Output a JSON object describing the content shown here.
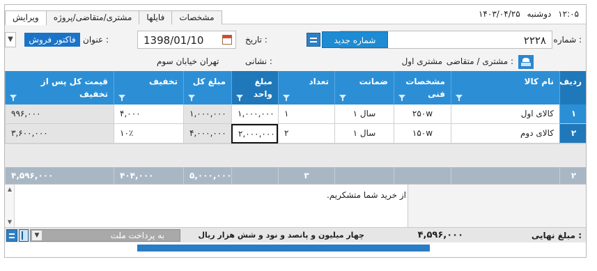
{
  "tabs": [
    "ویرایش",
    "مشتری/متقاضی/پروژه",
    "فایلها",
    "مشخصات"
  ],
  "datetime": {
    "weekday": "دوشنبه",
    "date": "۱۴۰۳/۰۴/۲۵",
    "time": "۱۲:۰۵"
  },
  "header": {
    "number_label": "شماره :",
    "number_value": "۲۲۲۸",
    "new_number_button": "شماره جدید",
    "date_label": "تاریخ :",
    "date_value": "1398/01/10",
    "title_label": "عنوان :",
    "title_value": "فاکتور فروش",
    "customer_label": "مشتری / متقاضی :",
    "customer_value": "مشتری اول",
    "address_label": "نشانی :",
    "address_value": "تهران خیابان سوم"
  },
  "columns": [
    "ردیف",
    "نام کالا",
    "مشخصات فنی",
    "ضمانت",
    "تعداد",
    "مبلغ واحد",
    "مبلغ کل",
    "تخفیف",
    "قیمت کل پس از تخفیف"
  ],
  "rows": [
    [
      "۱",
      "کالای اول",
      "۲۵۰w",
      "۱ سال",
      "۱",
      "۱,۰۰۰,۰۰۰",
      "۱,۰۰۰,۰۰۰",
      "۴,۰۰۰",
      "۹۹۶,۰۰۰"
    ],
    [
      "۲",
      "کالای دوم",
      "۱۵۰w",
      "۱ سال",
      "۲",
      "۲,۰۰۰,۰۰۰",
      "۴,۰۰۰,۰۰۰",
      "۱۰٪",
      "۳,۶۰۰,۰۰۰"
    ]
  ],
  "totals": {
    "row_count": "۲",
    "quantity": "۳",
    "total": "۵,۰۰۰,۰۰۰",
    "discount": "۴۰۴,۰۰۰",
    "final": "۴,۵۹۶,۰۰۰"
  },
  "note": "از خرید شما متشکریم.",
  "footer": {
    "final_label": "مبلغ نهایی :",
    "final_value": "۴,۵۹۶,۰۰۰",
    "final_words": "چهار میلیون و پانصد و نود و شش هزار  ریال",
    "payment_value": "به پرداخت ملت"
  },
  "colors": {
    "header_blue": "#2c8fd6",
    "header_dark": "#1f78ba",
    "totals_gray": "#a9b7c5",
    "title_blue": "#1a73c7"
  }
}
